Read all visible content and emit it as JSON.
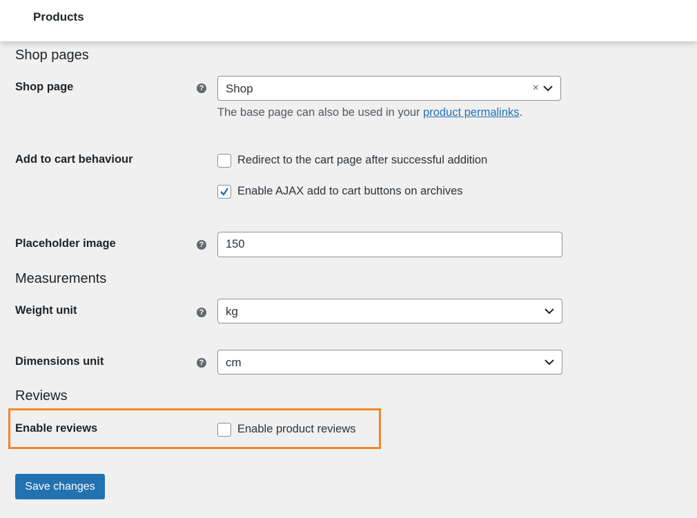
{
  "header": {
    "title": "Products"
  },
  "sections": {
    "shop_pages": "Shop pages",
    "measurements": "Measurements",
    "reviews": "Reviews"
  },
  "shop_page": {
    "label": "Shop page",
    "value": "Shop",
    "clear": "×",
    "desc_prefix": "The base page can also be used in your ",
    "desc_link": "product permalinks",
    "desc_suffix": "."
  },
  "add_to_cart": {
    "label": "Add to cart behaviour",
    "redirect_label": "Redirect to the cart page after successful addition",
    "redirect_checked": false,
    "ajax_label": "Enable AJAX add to cart buttons on archives",
    "ajax_checked": true
  },
  "placeholder_image": {
    "label": "Placeholder image",
    "value": "150"
  },
  "weight_unit": {
    "label": "Weight unit",
    "value": "kg"
  },
  "dimensions_unit": {
    "label": "Dimensions unit",
    "value": "cm"
  },
  "enable_reviews": {
    "label": "Enable reviews",
    "checkbox_label": "Enable product reviews",
    "checked": false
  },
  "help_glyph": "?",
  "save_button": "Save changes",
  "colors": {
    "accent": "#2271b1",
    "highlight": "#f0852a"
  }
}
